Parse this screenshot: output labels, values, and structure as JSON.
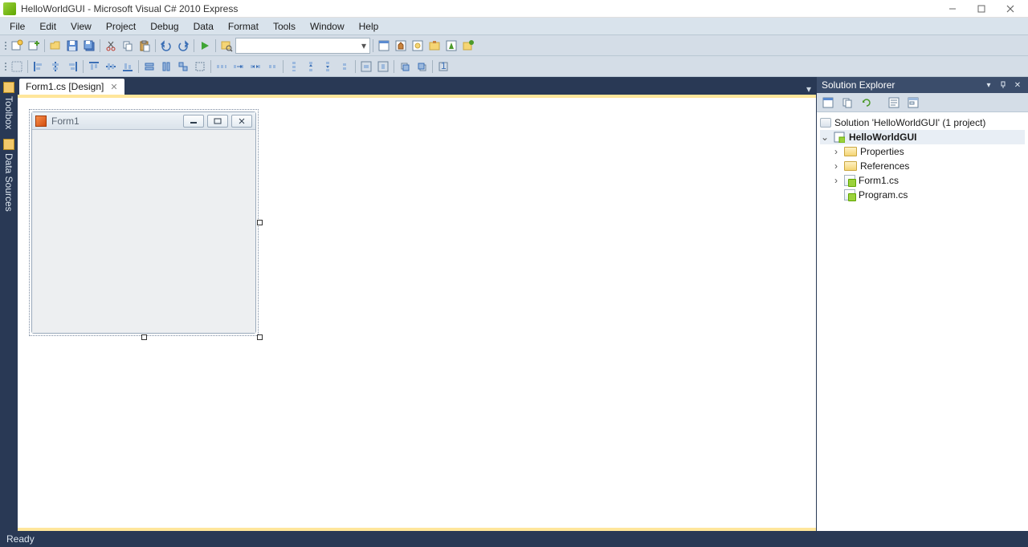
{
  "window": {
    "title": "HelloWorldGUI - Microsoft Visual C# 2010 Express"
  },
  "menu": [
    "File",
    "Edit",
    "View",
    "Project",
    "Debug",
    "Data",
    "Format",
    "Tools",
    "Window",
    "Help"
  ],
  "documentTab": {
    "label": "Form1.cs [Design]"
  },
  "sideTabs": {
    "toolbox": "Toolbox",
    "dataSources": "Data Sources"
  },
  "form": {
    "caption": "Form1"
  },
  "solutionExplorer": {
    "title": "Solution Explorer",
    "solution": "Solution 'HelloWorldGUI' (1 project)",
    "project": "HelloWorldGUI",
    "properties": "Properties",
    "references": "References",
    "form1": "Form1.cs",
    "program": "Program.cs"
  },
  "status": {
    "text": "Ready"
  }
}
